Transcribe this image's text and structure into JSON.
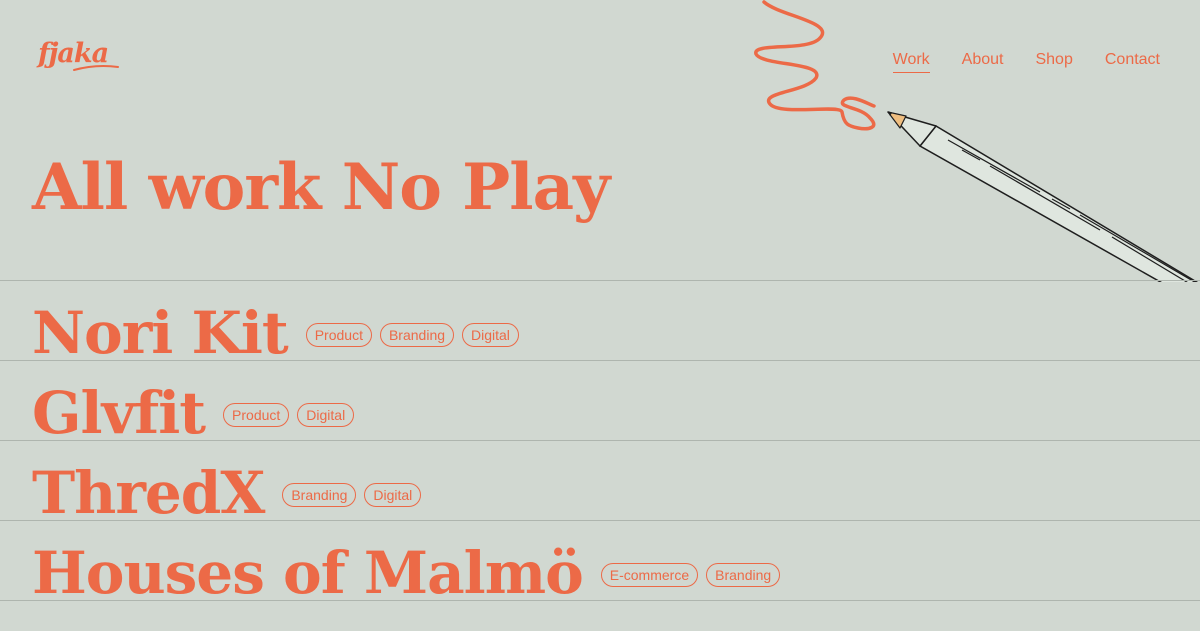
{
  "brand": {
    "logo_text": "fjaka",
    "accent_color": "#ec6a47",
    "background_color": "#d1d8d1"
  },
  "nav": {
    "items": [
      {
        "label": "Work",
        "active": true
      },
      {
        "label": "About",
        "active": false
      },
      {
        "label": "Shop",
        "active": false
      },
      {
        "label": "Contact",
        "active": false
      }
    ]
  },
  "hero": {
    "title": "All work No Play",
    "illustration": "pencil-scribble-icon"
  },
  "projects": [
    {
      "name": "Nori Kit",
      "tags": [
        "Product",
        "Branding",
        "Digital"
      ]
    },
    {
      "name": "Glvfit",
      "tags": [
        "Product",
        "Digital"
      ]
    },
    {
      "name": "ThredX",
      "tags": [
        "Branding",
        "Digital"
      ]
    },
    {
      "name": "Houses of Malmö",
      "tags": [
        "E-commerce",
        "Branding"
      ]
    }
  ]
}
